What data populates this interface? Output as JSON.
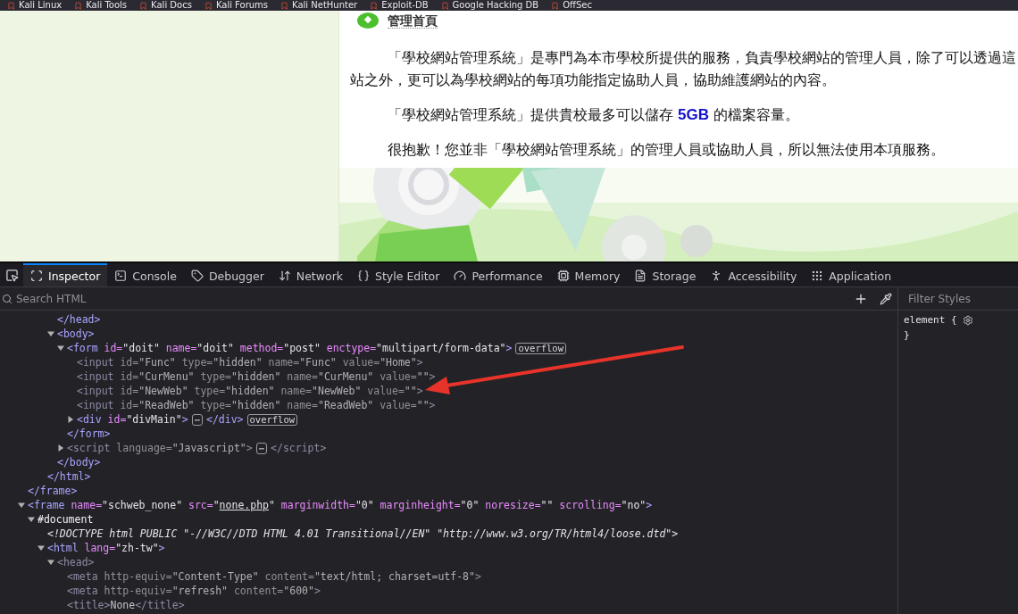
{
  "bookmarks": [
    {
      "label": "Kali Linux"
    },
    {
      "label": "Kali Tools"
    },
    {
      "label": "Kali Docs"
    },
    {
      "label": "Kali Forums"
    },
    {
      "label": "Kali NetHunter"
    },
    {
      "label": "Exploit-DB"
    },
    {
      "label": "Google Hacking DB"
    },
    {
      "label": "OffSec"
    }
  ],
  "page": {
    "heading": "管理首頁",
    "paragraphs": [
      {
        "lines": [
          "「學校網站管理系統」是專門為本市學校所提供的服務，負責學校網站的管理人員，除了可以透過這",
          "站之外，更可以為學校網站的每項功能指定協助人員，協助維護網站的內容。"
        ]
      },
      {
        "lines": [
          "「學校網站管理系統」提供貴校最多可以儲存 **5GB** 的檔案容量。"
        ]
      },
      {
        "lines": [
          "很抱歉！您並非「學校網站管理系統」的管理人員或協助人員，所以無法使用本項服務。"
        ]
      }
    ]
  },
  "devtools": {
    "tabs": [
      {
        "label": "Inspector",
        "kind": "inspector",
        "selected": true
      },
      {
        "label": "Console",
        "kind": "console",
        "selected": false
      },
      {
        "label": "Debugger",
        "kind": "debugger",
        "selected": false
      },
      {
        "label": "Network",
        "kind": "network",
        "selected": false
      },
      {
        "label": "Style Editor",
        "kind": "style",
        "selected": false
      },
      {
        "label": "Performance",
        "kind": "performance",
        "selected": false
      },
      {
        "label": "Memory",
        "kind": "memory",
        "selected": false
      },
      {
        "label": "Storage",
        "kind": "storage",
        "selected": false
      },
      {
        "label": "Accessibility",
        "kind": "accessibility",
        "selected": false
      },
      {
        "label": "Application",
        "kind": "application",
        "selected": false
      }
    ],
    "search": {
      "placeholder": "Search HTML"
    },
    "styles": {
      "placeholder": "Filter Styles",
      "rule_open": "element {",
      "rule_close": "}"
    },
    "tree": [
      {
        "children": [
          {
            "children": [
              {
                "children": [
                  {
                    "children": [
                      {
                        "hidden": false,
                        "tokens": [
                          {
                            "kind": "tag",
                            "text": "</head>"
                          }
                        ]
                      },
                      {
                        "hidden": false,
                        "expanded": true,
                        "tokens": [
                          {
                            "kind": "tag",
                            "text": "<body>"
                          }
                        ],
                        "children": [
                          {
                            "hidden": false,
                            "expanded": true,
                            "tokens": [
                              {
                                "kind": "tag",
                                "text": "<form"
                              },
                              {
                                "kind": "attr",
                                "text": "id="
                              },
                              {
                                "kind": "val",
                                "text": "\"doit\""
                              },
                              {
                                "kind": "attr",
                                "text": "name="
                              },
                              {
                                "kind": "val",
                                "text": "\"doit\""
                              },
                              {
                                "kind": "attr",
                                "text": "method="
                              },
                              {
                                "kind": "val",
                                "text": "\"post\""
                              },
                              {
                                "kind": "attr",
                                "text": "enctype="
                              },
                              {
                                "kind": "val",
                                "text": "\"multipart/form-data\""
                              },
                              {
                                "kind": "tag",
                                "text": ">"
                              },
                              {
                                "kind": "badge",
                                "text": "overflow"
                              }
                            ],
                            "children": [
                              {
                                "hidden": true,
                                "tokens": [
                                  {
                                    "kind": "tag",
                                    "text": "<input"
                                  },
                                  {
                                    "kind": "attr",
                                    "text": "id="
                                  },
                                  {
                                    "kind": "val",
                                    "text": "\"Func\""
                                  },
                                  {
                                    "kind": "attr",
                                    "text": "type="
                                  },
                                  {
                                    "kind": "val",
                                    "text": "\"hidden\""
                                  },
                                  {
                                    "kind": "attr",
                                    "text": "name="
                                  },
                                  {
                                    "kind": "val",
                                    "text": "\"Func\""
                                  },
                                  {
                                    "kind": "attr",
                                    "text": "value="
                                  },
                                  {
                                    "kind": "val",
                                    "text": "\"Home\""
                                  },
                                  {
                                    "kind": "tag",
                                    "text": ">"
                                  }
                                ]
                              },
                              {
                                "hidden": true,
                                "tokens": [
                                  {
                                    "kind": "tag",
                                    "text": "<input"
                                  },
                                  {
                                    "kind": "attr",
                                    "text": "id="
                                  },
                                  {
                                    "kind": "val",
                                    "text": "\"CurMenu\""
                                  },
                                  {
                                    "kind": "attr",
                                    "text": "type="
                                  },
                                  {
                                    "kind": "val",
                                    "text": "\"hidden\""
                                  },
                                  {
                                    "kind": "attr",
                                    "text": "name="
                                  },
                                  {
                                    "kind": "val",
                                    "text": "\"CurMenu\""
                                  },
                                  {
                                    "kind": "attr",
                                    "text": "value="
                                  },
                                  {
                                    "kind": "val",
                                    "text": "\"\""
                                  },
                                  {
                                    "kind": "tag",
                                    "text": ">"
                                  }
                                ]
                              },
                              {
                                "hidden": true,
                                "tokens": [
                                  {
                                    "kind": "tag",
                                    "text": "<input"
                                  },
                                  {
                                    "kind": "attr",
                                    "text": "id="
                                  },
                                  {
                                    "kind": "val",
                                    "text": "\"NewWeb\""
                                  },
                                  {
                                    "kind": "attr",
                                    "text": "type="
                                  },
                                  {
                                    "kind": "val",
                                    "text": "\"hidden\""
                                  },
                                  {
                                    "kind": "attr",
                                    "text": "name="
                                  },
                                  {
                                    "kind": "val",
                                    "text": "\"NewWeb\""
                                  },
                                  {
                                    "kind": "attr",
                                    "text": "value="
                                  },
                                  {
                                    "kind": "val",
                                    "text": "\"\""
                                  },
                                  {
                                    "kind": "tag",
                                    "text": ">"
                                  }
                                ]
                              },
                              {
                                "hidden": true,
                                "tokens": [
                                  {
                                    "kind": "tag",
                                    "text": "<input"
                                  },
                                  {
                                    "kind": "attr",
                                    "text": "id="
                                  },
                                  {
                                    "kind": "val",
                                    "text": "\"ReadWeb\""
                                  },
                                  {
                                    "kind": "attr",
                                    "text": "type="
                                  },
                                  {
                                    "kind": "val",
                                    "text": "\"hidden\""
                                  },
                                  {
                                    "kind": "attr",
                                    "text": "name="
                                  },
                                  {
                                    "kind": "val",
                                    "text": "\"ReadWeb\""
                                  },
                                  {
                                    "kind": "attr",
                                    "text": "value="
                                  },
                                  {
                                    "kind": "val",
                                    "text": "\"\""
                                  },
                                  {
                                    "kind": "tag",
                                    "text": ">"
                                  }
                                ]
                              },
                              {
                                "hidden": false,
                                "expanded": false,
                                "tokens": [
                                  {
                                    "kind": "tag",
                                    "text": "<div"
                                  },
                                  {
                                    "kind": "attr",
                                    "text": "id="
                                  },
                                  {
                                    "kind": "val",
                                    "text": "\"divMain\""
                                  },
                                  {
                                    "kind": "tag",
                                    "text": ">"
                                  },
                                  {
                                    "kind": "badge",
                                    "text": "⋯"
                                  },
                                  {
                                    "kind": "tag",
                                    "text": "</div>"
                                  },
                                  {
                                    "kind": "badge",
                                    "text": "overflow"
                                  }
                                ]
                              }
                            ]
                          },
                          {
                            "hidden": false,
                            "tokens": [
                              {
                                "kind": "tag",
                                "text": "</form>"
                              }
                            ]
                          },
                          {
                            "hidden": true,
                            "expanded": false,
                            "tokens": [
                              {
                                "kind": "tag",
                                "text": "<script"
                              },
                              {
                                "kind": "attr",
                                "text": "language="
                              },
                              {
                                "kind": "val",
                                "text": "\"Javascript\""
                              },
                              {
                                "kind": "tag",
                                "text": ">"
                              },
                              {
                                "kind": "badge",
                                "text": "⋯"
                              },
                              {
                                "kind": "tag",
                                "text": "</script>"
                              }
                            ]
                          }
                        ]
                      },
                      {
                        "hidden": false,
                        "tokens": [
                          {
                            "kind": "tag",
                            "text": "</body>"
                          }
                        ]
                      }
                    ]
                  },
                  {
                    "hidden": false,
                    "tokens": [
                      {
                        "kind": "tag",
                        "text": "</html>"
                      }
                    ]
                  }
                ]
              }
            ]
          },
          {
            "hidden": false,
            "tokens": [
              {
                "kind": "tag",
                "text": "</frame>"
              }
            ]
          },
          {
            "hidden": false,
            "expanded": true,
            "tokens": [
              {
                "kind": "tag",
                "text": "<frame"
              },
              {
                "kind": "attr",
                "text": "name="
              },
              {
                "kind": "val",
                "text": "\"schweb_none\""
              },
              {
                "kind": "attr",
                "text": "src="
              },
              {
                "kind": "val",
                "text": "\""
              },
              {
                "kind": "link",
                "text": "none.php"
              },
              {
                "kind": "val",
                "text": "\""
              },
              {
                "kind": "attr",
                "text": "marginwidth="
              },
              {
                "kind": "val",
                "text": "\"0\""
              },
              {
                "kind": "attr",
                "text": "marginheight="
              },
              {
                "kind": "val",
                "text": "\"0\""
              },
              {
                "kind": "attr",
                "text": "noresize="
              },
              {
                "kind": "val",
                "text": "\"\""
              },
              {
                "kind": "attr",
                "text": "scrolling="
              },
              {
                "kind": "val",
                "text": "\"no\""
              },
              {
                "kind": "tag",
                "text": ">"
              }
            ],
            "children": [
              {
                "hidden": false,
                "expanded": true,
                "tokens": [
                  {
                    "kind": "text",
                    "text": "#document"
                  }
                ],
                "children": [
                  {
                    "hidden": false,
                    "tokens": [
                      {
                        "kind": "doctype",
                        "text": "<!DOCTYPE html PUBLIC \"-//W3C//DTD HTML 4.01 Transitional//EN\" \"http://www.w3.org/TR/html4/loose.dtd\">"
                      }
                    ]
                  },
                  {
                    "hidden": false,
                    "expanded": true,
                    "tokens": [
                      {
                        "kind": "tag",
                        "text": "<html"
                      },
                      {
                        "kind": "attr",
                        "text": "lang="
                      },
                      {
                        "kind": "val",
                        "text": "\"zh-tw\""
                      },
                      {
                        "kind": "tag",
                        "text": ">"
                      }
                    ],
                    "children": [
                      {
                        "hidden": true,
                        "expanded": true,
                        "tokens": [
                          {
                            "kind": "tag",
                            "text": "<head>"
                          }
                        ],
                        "children": [
                          {
                            "hidden": true,
                            "tokens": [
                              {
                                "kind": "tag",
                                "text": "<meta"
                              },
                              {
                                "kind": "attr",
                                "text": "http-equiv="
                              },
                              {
                                "kind": "val",
                                "text": "\"Content-Type\""
                              },
                              {
                                "kind": "attr",
                                "text": "content="
                              },
                              {
                                "kind": "val",
                                "text": "\"text/html; charset=utf-8\""
                              },
                              {
                                "kind": "tag",
                                "text": ">"
                              }
                            ]
                          },
                          {
                            "hidden": true,
                            "tokens": [
                              {
                                "kind": "tag",
                                "text": "<meta"
                              },
                              {
                                "kind": "attr",
                                "text": "http-equiv="
                              },
                              {
                                "kind": "val",
                                "text": "\"refresh\""
                              },
                              {
                                "kind": "attr",
                                "text": "content="
                              },
                              {
                                "kind": "val",
                                "text": "\"600\""
                              },
                              {
                                "kind": "tag",
                                "text": ">"
                              }
                            ]
                          },
                          {
                            "hidden": true,
                            "tokens": [
                              {
                                "kind": "tag",
                                "text": "<title>"
                              },
                              {
                                "kind": "text",
                                "text": "None"
                              },
                              {
                                "kind": "tag",
                                "text": "</title>"
                              }
                            ]
                          }
                        ]
                      }
                    ]
                  }
                ]
              }
            ]
          }
        ]
      }
    ]
  }
}
